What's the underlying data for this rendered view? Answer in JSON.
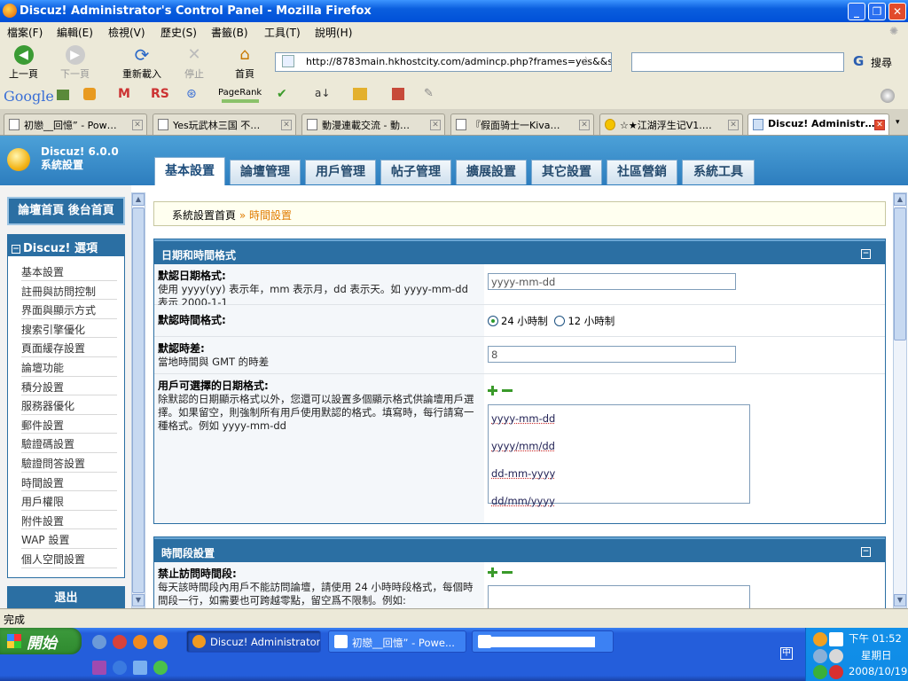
{
  "window": {
    "title": "Discuz! Administrator's Control Panel - Mozilla Firefox"
  },
  "menu": [
    "檔案(F)",
    "編輯(E)",
    "檢視(V)",
    "歷史(S)",
    "書籤(B)",
    "工具(T)",
    "說明(H)"
  ],
  "nav": {
    "back": "上一頁",
    "forward": "下一頁",
    "reload": "重新載入",
    "stop": "停止",
    "home": "首頁"
  },
  "url": "http://8783main.hkhostcity.com/admincp.php?frames=yes&&sid=",
  "search": {
    "label": "搜尋",
    "engine_glyph": "G"
  },
  "googlebar": {
    "logo": "Google",
    "rs": "RS",
    "pagerank": "PageRank"
  },
  "tabs": [
    {
      "label": "初戀__回憶” - Pow…"
    },
    {
      "label": "Yes玩武林三国 不…"
    },
    {
      "label": "動漫連載交流 - 動…"
    },
    {
      "label": "『假面骑士一Kiva…"
    },
    {
      "label": "☆★江湖浮生记V1.…"
    },
    {
      "label": "Discuz! Administr…"
    }
  ],
  "app": {
    "logo_line1": "Discuz! 6.0.0",
    "logo_line2": "系統設置",
    "top_tabs": [
      "基本設置",
      "論壇管理",
      "用戶管理",
      "帖子管理",
      "擴展設置",
      "其它設置",
      "社區營銷",
      "系統工具"
    ],
    "sidebar": {
      "home_links": "論壇首頁 後台首頁",
      "section_title": "Discuz! 選項",
      "section_toggle": "−",
      "items": [
        "基本設置",
        "註冊與訪問控制",
        "界面與顯示方式",
        "搜索引擎優化",
        "頁面緩存設置",
        "論壇功能",
        "積分設置",
        "服務器優化",
        "郵件設置",
        "驗證碼設置",
        "驗證問答設置",
        "時間設置",
        "用戶權限",
        "附件設置",
        "WAP 設置",
        "個人空間設置"
      ],
      "exit": "退出"
    },
    "breadcrumb": {
      "root": "系統設置首頁",
      "sep": " » ",
      "current": "時間設置"
    },
    "panel1": {
      "title": "日期和時間格式",
      "rows": [
        {
          "label": "默認日期格式:",
          "desc": "使用 yyyy(yy) 表示年，mm 表示月，dd 表示天。如 yyyy-mm-dd 表示 2000-1-1",
          "value": "yyyy-mm-dd"
        },
        {
          "label": "默認時間格式:",
          "opt1": "24 小時制",
          "opt2": "12 小時制"
        },
        {
          "label": "默認時差:",
          "desc": "當地時間與 GMT 的時差",
          "value": "8"
        },
        {
          "label": "用戶可選擇的日期格式:",
          "desc": "除默認的日期顯示格式以外，您還可以設置多個顯示格式供論壇用戶選擇。如果留空，則強制所有用戶使用默認的格式。填寫時，每行請寫一種格式。例如 yyyy-mm-dd",
          "formats": [
            "yyyy-mm-dd",
            "yyyy/mm/dd",
            "dd-mm-yyyy",
            "dd/mm/yyyy"
          ]
        }
      ]
    },
    "panel2": {
      "title": "時間段設置",
      "row_label": "禁止訪問時間段:",
      "row_desc": "每天該時間段內用戶不能訪問論壇，請使用 24 小時時段格式，每個時間段一行，如需要也可跨越零點，留空爲不限制。例如:"
    }
  },
  "status": "完成",
  "taskbar": {
    "start": "開始",
    "tasks": [
      "Discuz! Administrator'...",
      "初戀__回憶” - Powe..."
    ],
    "time": "下午 01:52",
    "day": "星期日",
    "date": "2008/10/19"
  },
  "colors": {
    "accent": "#2b6fa3",
    "highlight": "#e07b00"
  }
}
